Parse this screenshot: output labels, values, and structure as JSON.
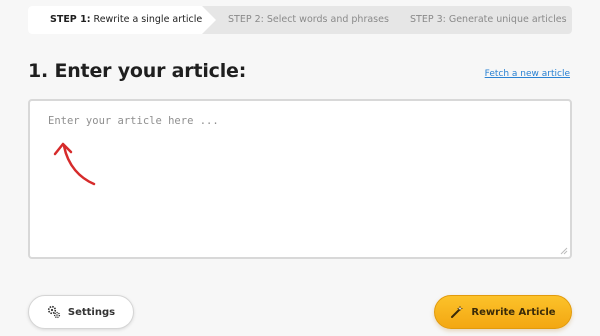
{
  "steps": [
    {
      "prefix": "STEP 1:",
      "label": " Rewrite a single article",
      "active": true
    },
    {
      "label": "STEP 2: Select words and phrases",
      "active": false
    },
    {
      "label": "STEP 3: Generate unique articles",
      "active": false
    }
  ],
  "main": {
    "heading": "1. Enter your article:",
    "fetch_link": "Fetch a new article",
    "article_placeholder": "Enter your article here ...",
    "article_value": ""
  },
  "buttons": {
    "settings_label": "Settings",
    "settings_icon": "gears-icon",
    "rewrite_label": "Rewrite Article",
    "rewrite_icon": "magic-wand-icon"
  },
  "colors": {
    "accent_button": "#f7b51c",
    "link": "#2a82d3",
    "annotation": "#d62b2b"
  }
}
